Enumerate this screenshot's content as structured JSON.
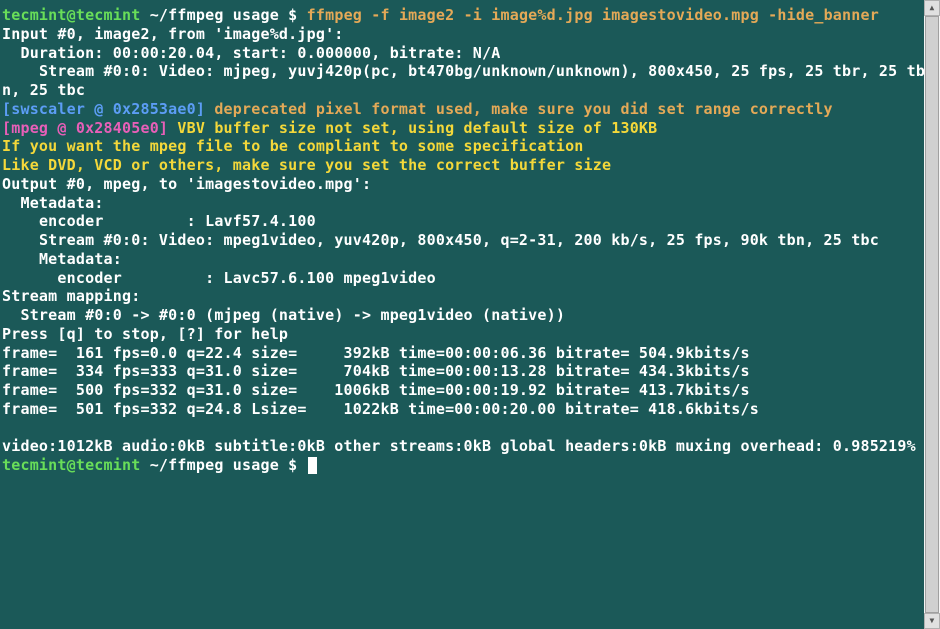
{
  "prompt1": {
    "user": "tecmint@tecmint",
    "path": " ~/ffmpeg usage ",
    "dollar": "$ ",
    "command": "ffmpeg -f image2 -i image%d.jpg imagestovideo.mpg -hide_banner"
  },
  "out": {
    "l1": "Input #0, image2, from 'image%d.jpg':",
    "l2": "  Duration: 00:00:20.04, start: 0.000000, bitrate: N/A",
    "l3": "    Stream #0:0: Video: mjpeg, yuvj420p(pc, bt470bg/unknown/unknown), 800x450, 25 fps, 25 tbr, 25 tbn, 25 tbc"
  },
  "sws": {
    "tag": "[swscaler @ 0x2853ae0] ",
    "msg": "deprecated pixel format used, make sure you did set range correctly"
  },
  "mpeg": {
    "tag": "[mpeg @ 0x28405e0] ",
    "msg": "VBV buffer size not set, using default size of 130KB"
  },
  "warn": {
    "l1": "If you want the mpeg file to be compliant to some specification",
    "l2": "Like DVD, VCD or others, make sure you set the correct buffer size"
  },
  "out2": {
    "l1": "Output #0, mpeg, to 'imagestovideo.mpg':",
    "l2": "  Metadata:",
    "l3": "    encoder         : Lavf57.4.100",
    "l4": "    Stream #0:0: Video: mpeg1video, yuv420p, 800x450, q=2-31, 200 kb/s, 25 fps, 90k tbn, 25 tbc",
    "l5": "    Metadata:",
    "l6": "      encoder         : Lavc57.6.100 mpeg1video",
    "l7": "Stream mapping:",
    "l8": "  Stream #0:0 -> #0:0 (mjpeg (native) -> mpeg1video (native))",
    "l9": "Press [q] to stop, [?] for help",
    "f1": "frame=  161 fps=0.0 q=22.4 size=     392kB time=00:00:06.36 bitrate= 504.9kbits/s",
    "f2": "frame=  334 fps=333 q=31.0 size=     704kB time=00:00:13.28 bitrate= 434.3kbits/s",
    "f3": "frame=  500 fps=332 q=31.0 size=    1006kB time=00:00:19.92 bitrate= 413.7kbits/s",
    "f4": "frame=  501 fps=332 q=24.8 Lsize=    1022kB time=00:00:20.00 bitrate= 418.6kbits/s",
    "sum": "video:1012kB audio:0kB subtitle:0kB other streams:0kB global headers:0kB muxing overhead: 0.985219%"
  },
  "prompt2": {
    "user": "tecmint@tecmint",
    "path": " ~/ffmpeg usage ",
    "dollar": "$ "
  },
  "scrollbar": {
    "up": "▲",
    "down": "▼"
  }
}
